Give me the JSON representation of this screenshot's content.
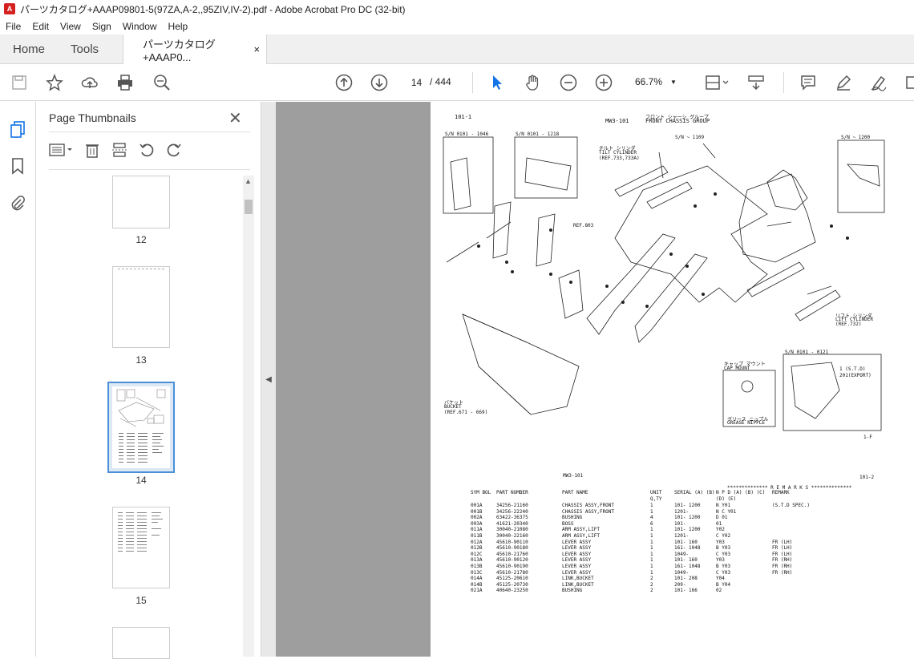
{
  "window": {
    "title": "パーツカタログ+AAAP09801-5(97ZA,A-2,,95ZIV,IV-2).pdf - Adobe Acrobat Pro DC (32-bit)"
  },
  "menu": [
    "File",
    "Edit",
    "View",
    "Sign",
    "Window",
    "Help"
  ],
  "tabs": {
    "home": "Home",
    "tools": "Tools",
    "document": "パーツカタログ+AAAP0...",
    "close": "×"
  },
  "toolbar": {
    "current_page": "14",
    "total_pages": "/ 444",
    "zoom": "66.7%"
  },
  "thumbnails": {
    "title": "Page Thumbnails",
    "close": "✕",
    "pages": [
      "12",
      "13",
      "14",
      "15"
    ],
    "selected": "14"
  },
  "page": {
    "header_left": "101-1",
    "header_model": "MW3-101",
    "header_title_jp": "フロント シャーシ グループ",
    "header_title": "FRONT CHASSIS GROUP",
    "labels": [
      "S/N 0101 - 1046",
      "S/N 0101 - 1218",
      "S/N ~ 1109",
      "S/N ~ 1200",
      "チルト シリンダ",
      "TILT CYLINDER",
      "(REF.733,733A)",
      "REF.803",
      "リフト シリンダ",
      "LIFT CYLINDER",
      "(REF.732)",
      "S/N 0101 - 0121",
      "キャップ マウント",
      "CAP MOUNT",
      "グリース ニップル",
      "GREASE NIPPLE",
      "バケット",
      "BUCKET",
      "(REF.671 - 669)",
      "1 (S.T.D)",
      "201(EXPORT)",
      "1-F"
    ],
    "table_header_left": "MW3-101",
    "table_header_right": "101-2",
    "columns": [
      "SYM BOL",
      "PART NUMBER",
      "PART NAME",
      "UNIT Q,TY",
      "SERIAL (A) (B)",
      "N P D (A) (B) (C) (D) (E)",
      "REMARK"
    ],
    "remarks_banner": "************** R E M A R K S **************",
    "rows": [
      [
        "001A",
        "34256-21160",
        "CHASSIS ASSY,FRONT",
        "1",
        "101- 1200",
        "N   Y01",
        "(S.T.D SPEC.)"
      ],
      [
        "001B",
        "34256-22240",
        "CHASSIS ASSY,FRONT",
        "1",
        "1201-",
        "N C  Y01",
        ""
      ],
      [
        "002A",
        "63422-36375",
        "BUSHING",
        "4",
        "101- 1200",
        "D  01",
        ""
      ],
      [
        "003A",
        "41621-20340",
        "BOSS",
        "6",
        "101-",
        "01",
        ""
      ],
      [
        "011A",
        "30040-21080",
        "ARM ASSY,LIFT",
        "1",
        "101- 1200",
        "Y02",
        ""
      ],
      [
        "011B",
        "30040-22160",
        "ARM ASSY,LIFT",
        "1",
        "1201-",
        "C  Y02",
        ""
      ],
      [
        "012A",
        "45610-90110",
        "LEVER ASSY",
        "1",
        "101- 160",
        "Y03",
        "FR (LH)"
      ],
      [
        "012B",
        "45610-90180",
        "LEVER ASSY",
        "1",
        "161- 1048",
        "B  Y03",
        "FR (LH)"
      ],
      [
        "012C",
        "45610-21760",
        "LEVER ASSY",
        "1",
        "1049-",
        "C  Y03",
        "FR (LH)"
      ],
      [
        "013A",
        "45610-90120",
        "LEVER ASSY",
        "1",
        "101- 160",
        "Y03",
        "FR (RH)"
      ],
      [
        "013B",
        "45610-90190",
        "LEVER ASSY",
        "1",
        "161- 1048",
        "B  Y03",
        "FR (RH)"
      ],
      [
        "013C",
        "45610-21780",
        "LEVER ASSY",
        "1",
        "1049-",
        "C  Y03",
        "FR (RH)"
      ],
      [
        "014A",
        "45125-20610",
        "LINK,BUCKET",
        "2",
        "101- 208",
        "Y04",
        ""
      ],
      [
        "014B",
        "45125-20730",
        "LINK,BUCKET",
        "2",
        "209-",
        "B  Y04",
        ""
      ],
      [
        "021A",
        "40640-23250",
        "BUSHING",
        "2",
        "101- 166",
        "02",
        ""
      ]
    ]
  }
}
